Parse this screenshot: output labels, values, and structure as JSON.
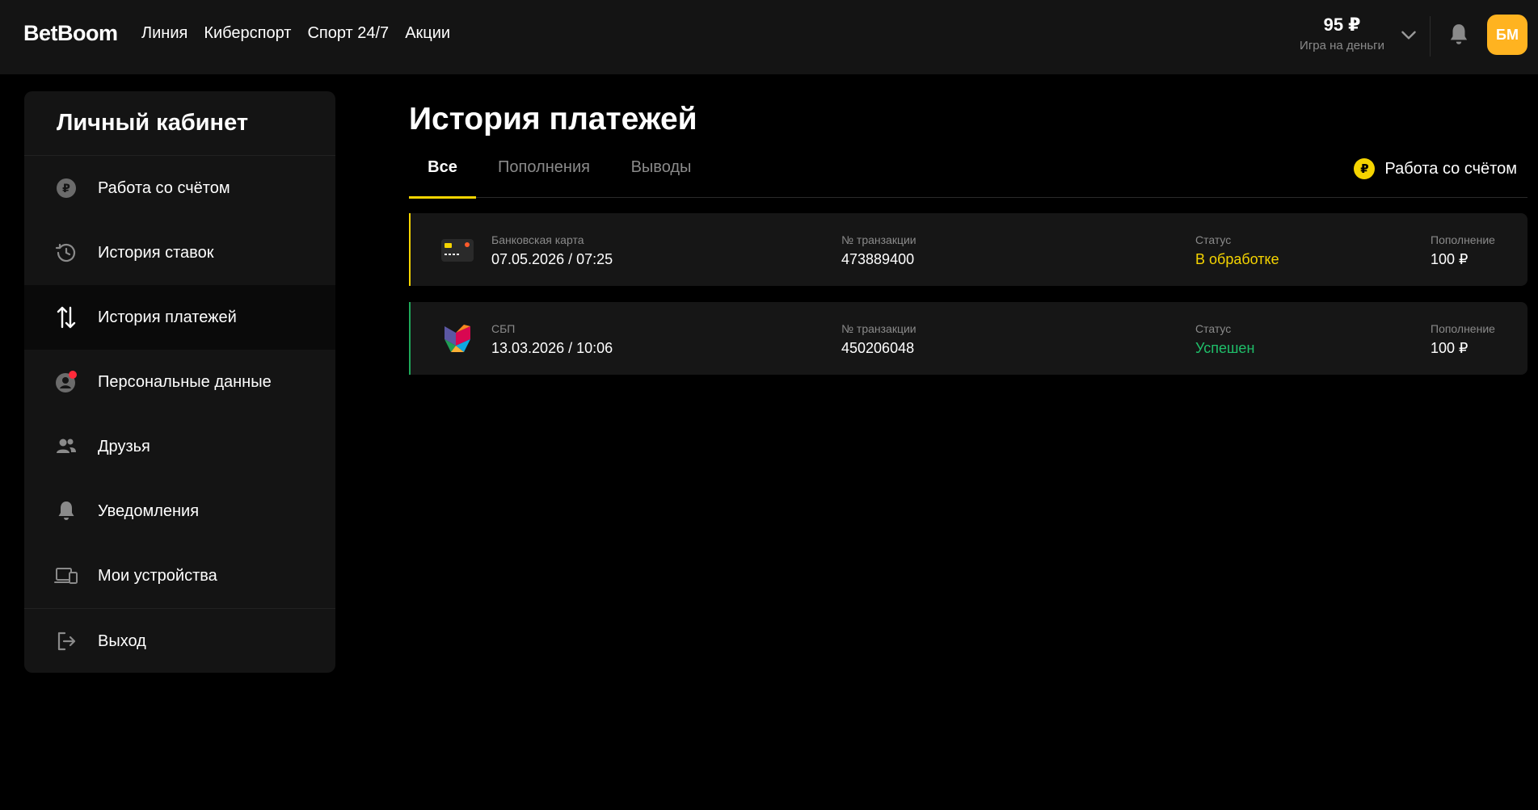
{
  "header": {
    "logo": "BetBoom",
    "nav": [
      "Линия",
      "Киберспорт",
      "Спорт 24/7",
      "Акции"
    ],
    "balance_amount": "95 ₽",
    "balance_label": "Игра на деньги",
    "avatar_initials": "БМ",
    "accent_color": "#ffb320"
  },
  "sidebar": {
    "title": "Личный кабинет",
    "items": [
      {
        "label": "Работа со счётом",
        "icon": "ruble-coin-icon"
      },
      {
        "label": "История ставок",
        "icon": "history-icon"
      },
      {
        "label": "История платежей",
        "icon": "transfer-arrows-icon",
        "active": true
      },
      {
        "label": "Персональные данные",
        "icon": "user-circle-icon"
      },
      {
        "label": "Друзья",
        "icon": "friends-icon"
      },
      {
        "label": "Уведомления",
        "icon": "bell-icon"
      },
      {
        "label": "Мои устройства",
        "icon": "devices-icon"
      },
      {
        "label": "Выход",
        "icon": "logout-icon"
      }
    ]
  },
  "main": {
    "title": "История платежей",
    "tabs": [
      {
        "label": "Все",
        "active": true
      },
      {
        "label": "Пополнения"
      },
      {
        "label": "Выводы"
      }
    ],
    "account_link": "Работа со счётом",
    "coin_symbol": "₽",
    "transactions": [
      {
        "method": "Банковская карта",
        "datetime": "07.05.2026 / 07:25",
        "tx_label": "№ транзакции",
        "tx_number": "473889400",
        "status_label": "Статус",
        "status": "В обработке",
        "type_label": "Пополнение",
        "amount": "100 ₽",
        "status_color": "#f5d400"
      },
      {
        "method": "СБП",
        "datetime": "13.03.2026 / 10:06",
        "tx_label": "№ транзакции",
        "tx_number": "450206048",
        "status_label": "Статус",
        "status": "Успешен",
        "type_label": "Пополнение",
        "amount": "100 ₽",
        "status_color": "#1fbf6a"
      }
    ]
  }
}
